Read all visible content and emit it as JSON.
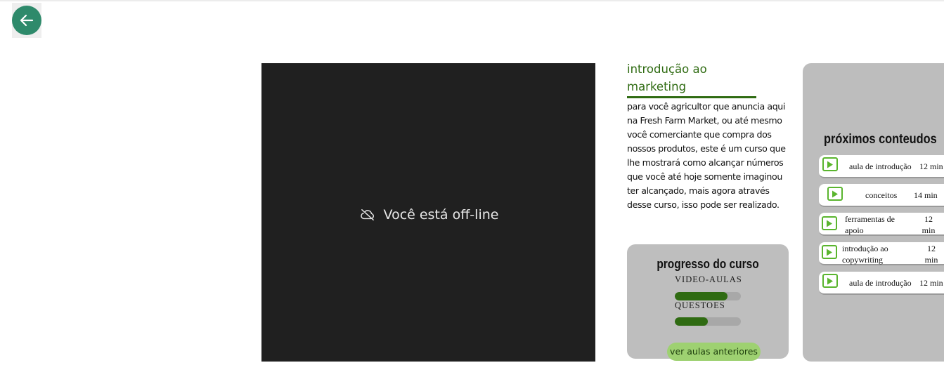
{
  "nav": {
    "back_icon": "arrow-left-icon",
    "accent": "#2e8a6b"
  },
  "video": {
    "offline_icon": "cloud-off-icon",
    "offline_text": "Você está off-line"
  },
  "course": {
    "title": "introdução ao marketing",
    "description": "para você agricultor que anuncia aqui na Fresh Farm Market, ou até mesmo você comerciante que compra dos nossos produtos, este é um curso que lhe mostrará como alcançar números que você até hoje somente imaginou ter alcançado, mais agora através desse curso, isso pode ser realizado.",
    "title_color": "#2f6b12"
  },
  "progress": {
    "title": "progresso do curso",
    "videos_label": "VIDEO-AULAS",
    "videos_fraction": 0.8,
    "questions_label": "QUESTOES",
    "questions_fraction": 0.5,
    "prev_button": "ver aulas anteriores",
    "fill_color": "#2f6b12",
    "button_color": "#9ed171"
  },
  "next": {
    "title": "próximos conteudos",
    "lessons": [
      {
        "name": "aula de introdução",
        "duration": "12 min"
      },
      {
        "name": "conceitos",
        "duration": "14 min"
      },
      {
        "name": "ferramentas de apoio",
        "duration": "12 min"
      },
      {
        "name": "introdução ao copywriting",
        "duration": "12 min"
      },
      {
        "name": "aula de introdução",
        "duration": "12 min"
      }
    ],
    "play_icon": "play-icon",
    "play_color": "#5ab52e"
  }
}
